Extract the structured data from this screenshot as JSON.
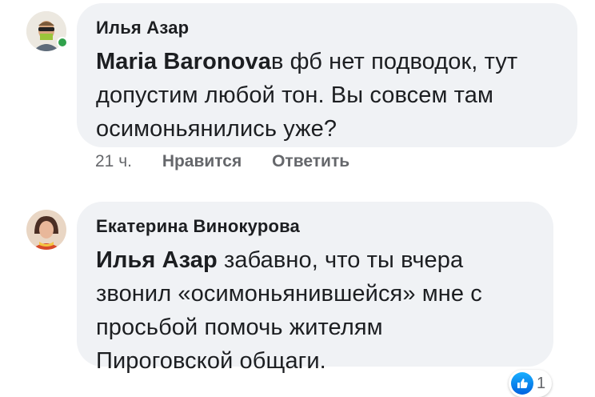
{
  "comments": [
    {
      "author": "Илья Азар",
      "mention": "Maria Baronova",
      "lines": [
        "в фб нет подводок, тут",
        "допустим любой тон. Вы совсем там",
        "осимоньянились уже?"
      ],
      "time": "21 ч.",
      "like_label": "Нравится",
      "reply_label": "Ответить",
      "online": true
    },
    {
      "author": "Екатерина Винокурова",
      "mention": "Илья Азар",
      "lines": [
        " забавно, что ты вчера",
        "звонил «осимоньянившейся» мне с",
        "просьбой помочь жителям",
        "Пироговской общаги."
      ],
      "reaction_count": "1"
    }
  ],
  "colors": {
    "bubble": "#f0f2f5",
    "text": "#1c1e21",
    "meta": "#65676b",
    "online": "#31a24c",
    "like": "#1877f2"
  }
}
